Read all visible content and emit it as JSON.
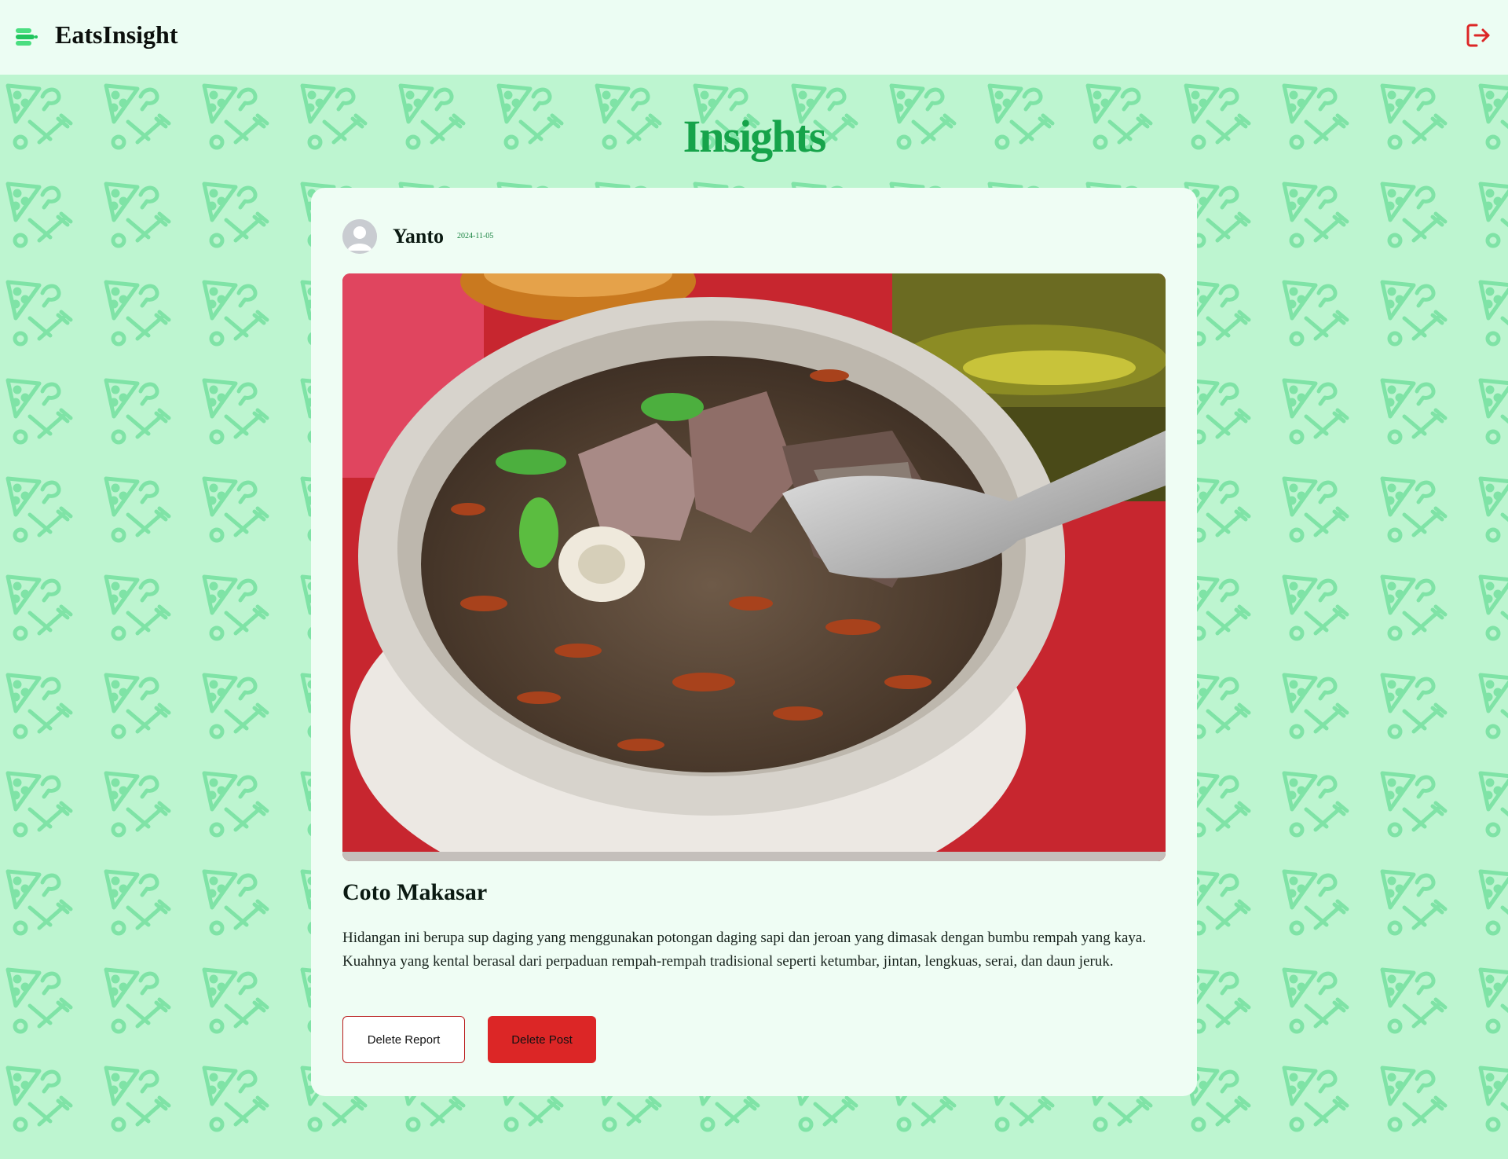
{
  "app": {
    "name": "EatsInsight"
  },
  "header": {
    "menu_icon": "menu-food-icon",
    "logout_icon": "logout-icon"
  },
  "page": {
    "title": "Insights"
  },
  "post": {
    "author": "Yanto",
    "date": "2024-11-05",
    "image_alt": "Coto Makasar soup photo",
    "title": "Coto Makasar",
    "description": "Hidangan ini berupa sup daging yang menggunakan potongan daging sapi dan jeroan yang dimasak dengan bumbu rempah yang kaya. Kuahnya yang kental berasal dari perpaduan rempah-rempah tradisional seperti ketumbar, jintan, lengkuas, serai, dan daun jeruk."
  },
  "actions": {
    "delete_report": "Delete Report",
    "delete_post": "Delete Post"
  },
  "colors": {
    "background": "#bdf5d0",
    "header": "#ecfdf3",
    "accent_green": "#16a34a",
    "pattern_icon": "#7fe3a6",
    "danger": "#dc2626"
  }
}
